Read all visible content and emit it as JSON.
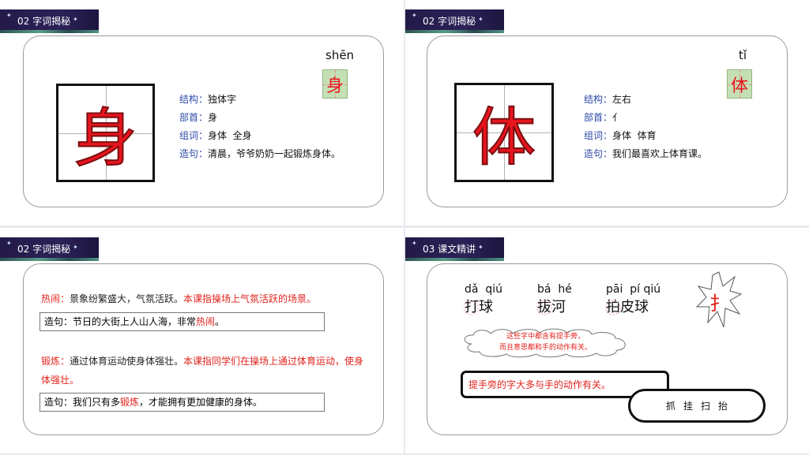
{
  "slides": [
    {
      "header": "02 字词揭秘",
      "char": "身",
      "pinyin": "shēn",
      "fields": [
        {
          "label": "结构：",
          "value": "独体字"
        },
        {
          "label": "部首：",
          "value": "身"
        },
        {
          "label": "组词：",
          "value": "身体  全身"
        },
        {
          "label": "造句：",
          "value": "清晨，爷爷奶奶一起锻炼身体。"
        }
      ]
    },
    {
      "header": "02 字词揭秘",
      "char": "体",
      "pinyin": "tǐ",
      "fields": [
        {
          "label": "结构：",
          "value": "左右"
        },
        {
          "label": "部首：",
          "value": "亻"
        },
        {
          "label": "组词：",
          "value": "身体  体育"
        },
        {
          "label": "造句：",
          "value": "我们最喜欢上体育课。"
        }
      ]
    },
    {
      "header": "02 字词揭秘",
      "defs": [
        {
          "term": "热闹：",
          "meaning": "景象纷繁盛大，气氛活跃。",
          "lesson": "本课指操场上气氛活跃的场景。",
          "sentence_pre": "造句：节日的大街上人山人海，非常",
          "sentence_word": "热闹",
          "sentence_post": "。"
        },
        {
          "term": "锻炼：",
          "meaning": "通过体育运动使身体强壮。",
          "lesson": "本课指同学们在操场上通过体育运动，使身体强壮。",
          "sentence_pre": "造句：我们只有多",
          "sentence_word": "锻炼",
          "sentence_post": "，才能拥有更加健康的身体。"
        }
      ]
    },
    {
      "header": "03 课文精讲",
      "words": [
        {
          "pinyin": "dǎ  qiú",
          "radical": "扌",
          "text": "打球"
        },
        {
          "pinyin": "bá  hé",
          "radical": "扌",
          "text": "拔河"
        },
        {
          "pinyin": "pāi  pí qiú",
          "radical": "扌",
          "text": "拍皮球"
        }
      ],
      "burst_char": "扌",
      "cloud_line1": "这些字中都含有提手旁，",
      "cloud_line2": "而且意思都和手的动作有关。",
      "note": "提手旁的字大多与手的动作有关。",
      "examples": [
        "抓",
        "挂",
        "扫",
        "抬"
      ]
    }
  ]
}
